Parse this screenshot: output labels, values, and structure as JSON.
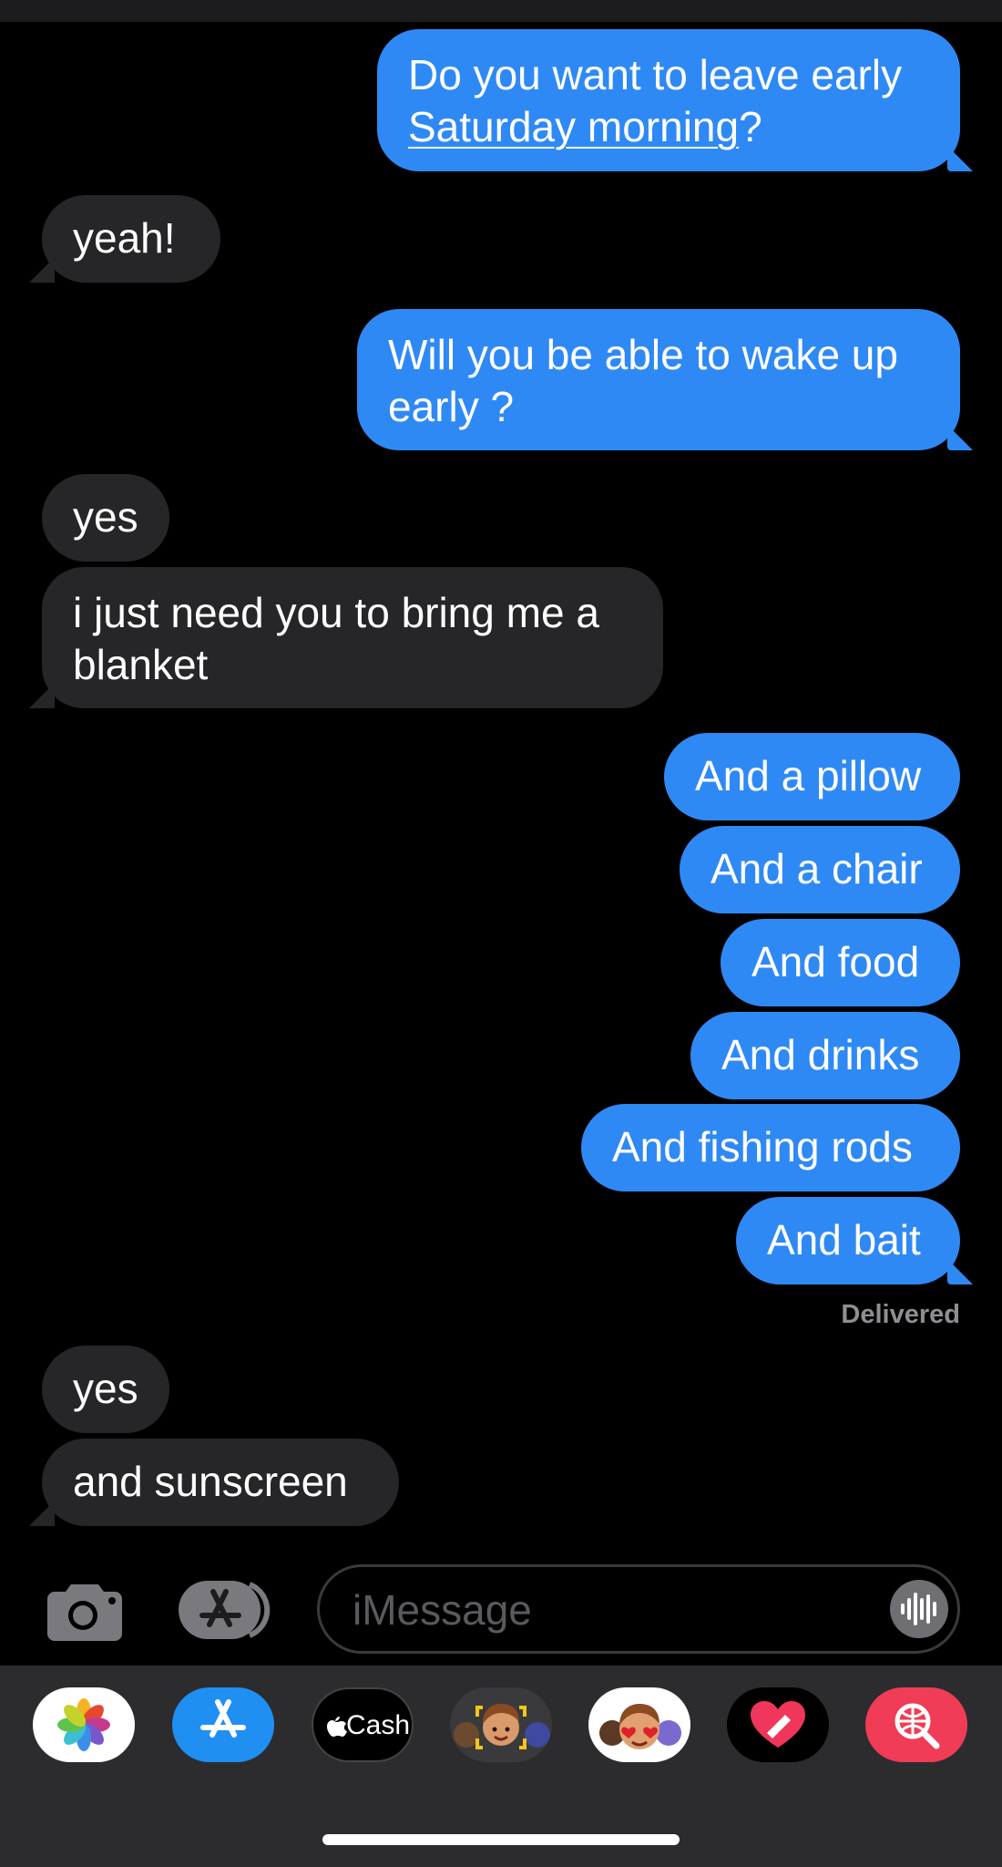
{
  "messages": [
    {
      "id": "m1",
      "dir": "out",
      "lines": [
        [
          "Do you want to leave early"
        ],
        [
          "Saturday morning",
          "?"
        ]
      ]
    },
    {
      "id": "m2",
      "dir": "in",
      "text": "yeah!"
    },
    {
      "id": "m3",
      "dir": "out",
      "lines": [
        [
          "Will you be able to wake up"
        ],
        [
          "early ?"
        ]
      ]
    },
    {
      "id": "m4",
      "dir": "in",
      "text": "yes"
    },
    {
      "id": "m5",
      "dir": "in",
      "lines": [
        [
          "i just need you to bring me a"
        ],
        [
          "blanket"
        ]
      ]
    },
    {
      "id": "m6",
      "dir": "out",
      "text": "And a pillow"
    },
    {
      "id": "m7",
      "dir": "out",
      "text": "And a chair"
    },
    {
      "id": "m8",
      "dir": "out",
      "text": "And food"
    },
    {
      "id": "m9",
      "dir": "out",
      "text": "And drinks"
    },
    {
      "id": "m10",
      "dir": "out",
      "text": "And fishing rods"
    },
    {
      "id": "m11",
      "dir": "out",
      "text": "And bait"
    },
    {
      "id": "m12",
      "dir": "in",
      "text": "yes"
    },
    {
      "id": "m13",
      "dir": "in",
      "text": "and sunscreen"
    }
  ],
  "status": {
    "delivered": "Delivered"
  },
  "composer": {
    "placeholder": "iMessage"
  },
  "apps": {
    "cash_label": "Cash",
    "icons": [
      "photos-icon",
      "app-store-icon",
      "apple-cash-icon",
      "memoji-icon",
      "memoji-stickers-icon",
      "digital-touch-icon",
      "images-search-icon"
    ]
  },
  "colors": {
    "outgoing": "#2f89f5",
    "incoming": "#262628",
    "background": "#000000",
    "drawer": "#2c2c2e"
  }
}
